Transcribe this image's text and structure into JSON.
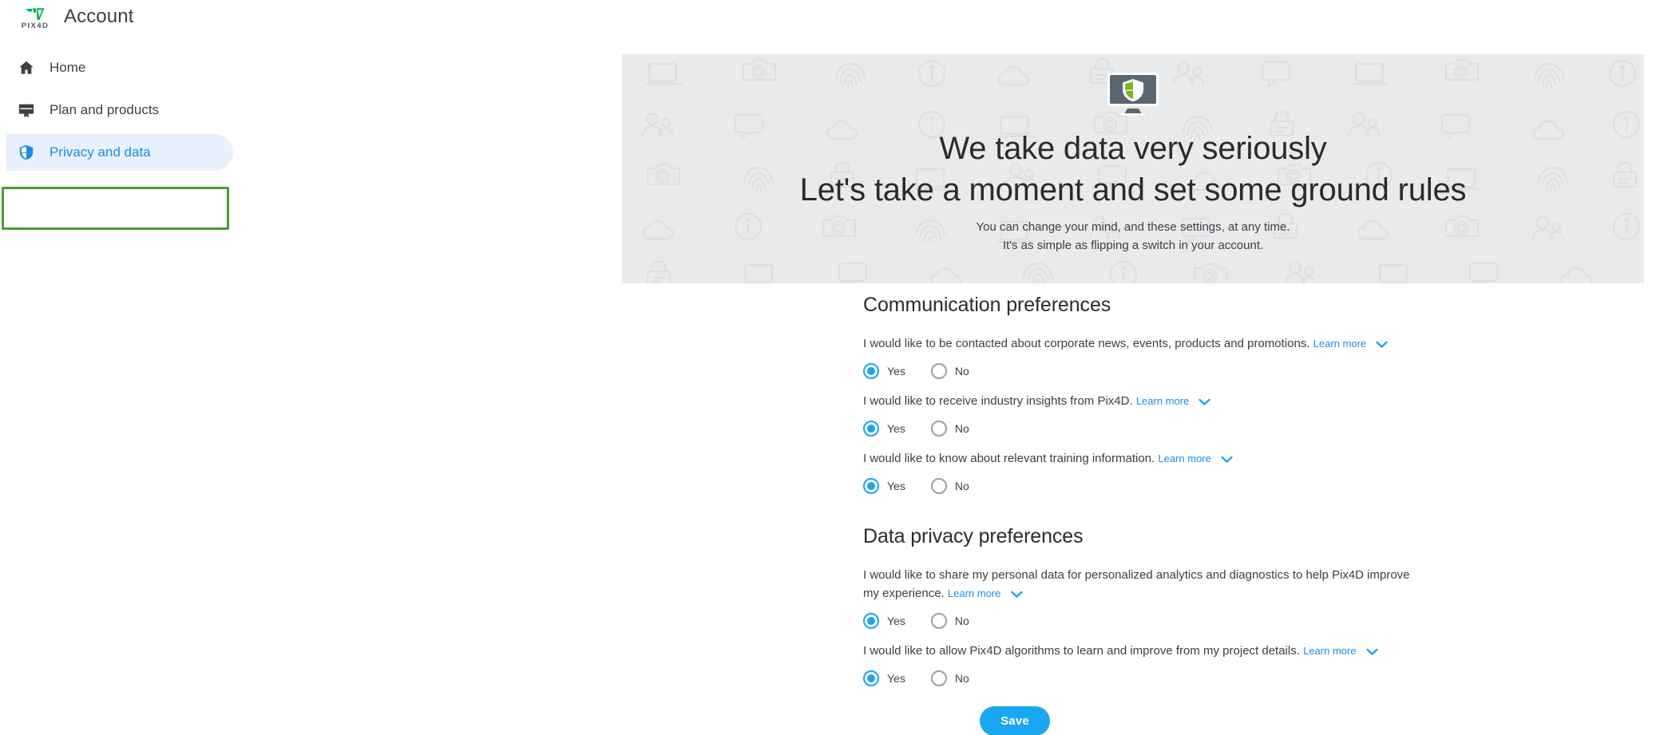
{
  "header": {
    "logo_word": "PIX4D",
    "logo_icon": "pix4d-logo-mark",
    "title": "Account"
  },
  "sidebar": {
    "items": [
      {
        "label": "Home",
        "icon": "home-icon",
        "active": false
      },
      {
        "label": "Plan and products",
        "icon": "monitor-icon",
        "active": false
      },
      {
        "label": "Privacy and data",
        "icon": "shield-icon",
        "active": true
      }
    ],
    "highlight_color": "#4f9a2f",
    "active_bg": "#e8f0fe",
    "active_color": "#1a8fe0"
  },
  "banner": {
    "icon": "monitor-shield-icon",
    "heading_line1": "We take data very seriously",
    "heading_line2": "Let's take a moment and set some ground rules",
    "sub_line1": "You can change your mind, and these settings, at any time.",
    "sub_line2": "It's as simple as flipping a switch in your account.",
    "background_color": "#e9eaec",
    "pattern_icons": [
      "laptop-icon",
      "camera-icon",
      "fingerprint-icon",
      "info-icon",
      "cloud-icon",
      "lock-icon",
      "people-icon",
      "speech-bubble-icon"
    ]
  },
  "main": {
    "sections": [
      {
        "title": "Communication preferences",
        "prefs": [
          {
            "text": "I would like to be contacted about corporate news, events, products and promotions.",
            "learn_more": "Learn more",
            "chevron": "chevron-down-icon",
            "selected": "Yes",
            "options": [
              {
                "label": "Yes",
                "checked": true
              },
              {
                "label": "No",
                "checked": false
              }
            ]
          },
          {
            "text": "I would like to receive industry insights from Pix4D.",
            "learn_more": "Learn more",
            "chevron": "chevron-down-icon",
            "selected": "Yes",
            "options": [
              {
                "label": "Yes",
                "checked": true
              },
              {
                "label": "No",
                "checked": false
              }
            ]
          },
          {
            "text": "I would like to know about relevant training information.",
            "learn_more": "Learn more",
            "chevron": "chevron-down-icon",
            "selected": "Yes",
            "options": [
              {
                "label": "Yes",
                "checked": true
              },
              {
                "label": "No",
                "checked": false
              }
            ]
          }
        ]
      },
      {
        "title": "Data privacy preferences",
        "prefs": [
          {
            "text": "I would like to share my personal data for personalized analytics and diagnostics to help Pix4D improve my experience.",
            "learn_more": "Learn more",
            "chevron": "chevron-down-icon",
            "selected": "Yes",
            "options": [
              {
                "label": "Yes",
                "checked": true
              },
              {
                "label": "No",
                "checked": false
              }
            ]
          },
          {
            "text": "I would like to allow Pix4D algorithms to learn and improve from my project details.",
            "learn_more": "Learn more",
            "chevron": "chevron-down-icon",
            "selected": "Yes",
            "options": [
              {
                "label": "Yes",
                "checked": true
              },
              {
                "label": "No",
                "checked": false
              }
            ]
          }
        ]
      }
    ],
    "save_label": "Save",
    "accent_color": "#19a7f0"
  }
}
